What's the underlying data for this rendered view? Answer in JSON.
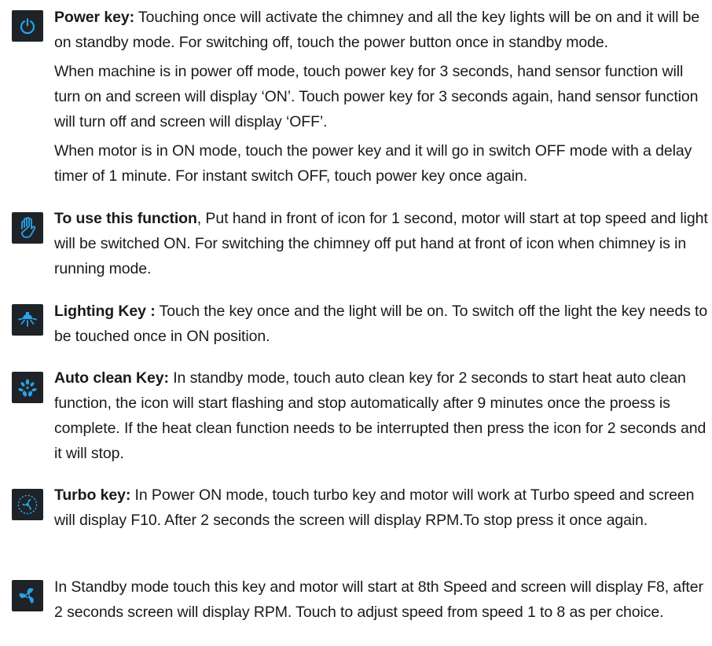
{
  "colors": {
    "icon_background": "#1e2328",
    "icon_accent": "#29a3e8",
    "text": "#1a1a1a"
  },
  "sections": [
    {
      "icon": "power-icon",
      "title": "Power key:",
      "paragraphs": [
        " Touching once will activate the chimney and all the key lights will be on and it will be on standby mode. For switching off, touch the power button once in standby mode.",
        "When machine is in power off mode, touch power key for 3 seconds, hand sensor function will turn on and screen will display ‘ON’. Touch power key for 3 seconds again, hand sensor function will turn off and screen will display ‘OFF’.",
        "When motor is in ON mode, touch the power key and it will go in switch OFF mode with a delay timer of 1 minute. For instant switch OFF, touch power key once again."
      ]
    },
    {
      "icon": "hand-icon",
      "title": "To use this function",
      "paragraphs": [
        ", Put hand in front of icon for 1 second, motor will start at top speed and light will be switched ON. For switching the chimney off put hand at front of icon when chimney is in running mode."
      ]
    },
    {
      "icon": "light-icon",
      "title": "Lighting Key :",
      "paragraphs": [
        " Touch the key once and the light will be on. To switch off the light the key needs to be touched once in ON position."
      ]
    },
    {
      "icon": "auto-clean-icon",
      "title": "Auto clean Key:",
      "paragraphs": [
        " In standby mode, touch auto clean key for 2 seconds to start heat auto clean function, the icon will start flashing and stop automatically after 9 minutes once the proess is complete. If the heat clean function needs to be interrupted then press the icon for 2 seconds and it will stop."
      ]
    },
    {
      "icon": "turbo-icon",
      "title": "Turbo key:",
      "paragraphs": [
        " In Power ON mode, touch turbo key and motor will work at Turbo speed and screen will display F10. After 2 seconds the screen will display RPM.To stop press it once again."
      ]
    },
    {
      "icon": "fan-speed-icon",
      "title": "",
      "paragraphs": [
        "In Standby mode touch this key and motor will start at 8th Speed and screen will display F8, after 2 seconds screen will display RPM. Touch to adjust speed from speed 1 to 8 as per choice."
      ]
    }
  ]
}
